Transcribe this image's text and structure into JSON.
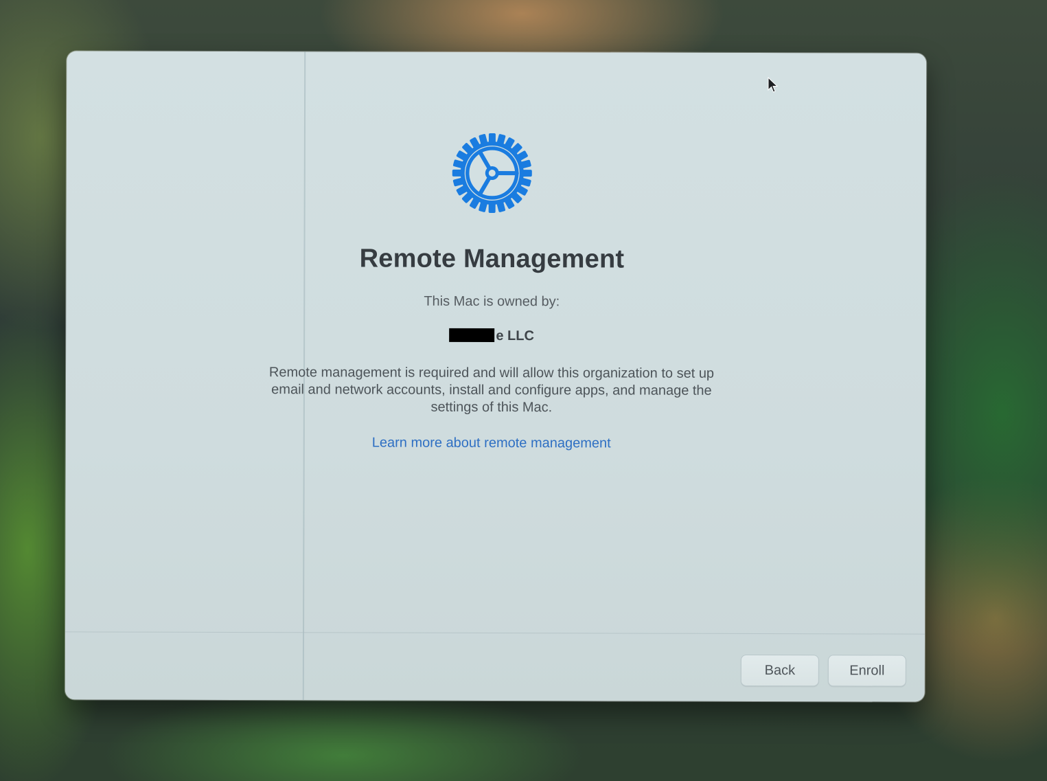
{
  "window": {
    "title": "Remote Management",
    "owned_by_label": "This Mac is owned by:",
    "owner_name_visible": "e LLC",
    "description": "Remote management is required and will allow this organization to set up email and network accounts, install and configure apps, and manage the settings of this Mac.",
    "learn_more_link": "Learn more about remote management"
  },
  "footer": {
    "back_label": "Back",
    "enroll_label": "Enroll"
  },
  "icons": {
    "header_icon": "gear-icon",
    "pointer": "mouse-pointer-icon"
  },
  "colors": {
    "accent": "#1a7ce0",
    "link": "#2e6fc3",
    "window_background": "#d3e0e2",
    "title_text": "#363c41"
  }
}
